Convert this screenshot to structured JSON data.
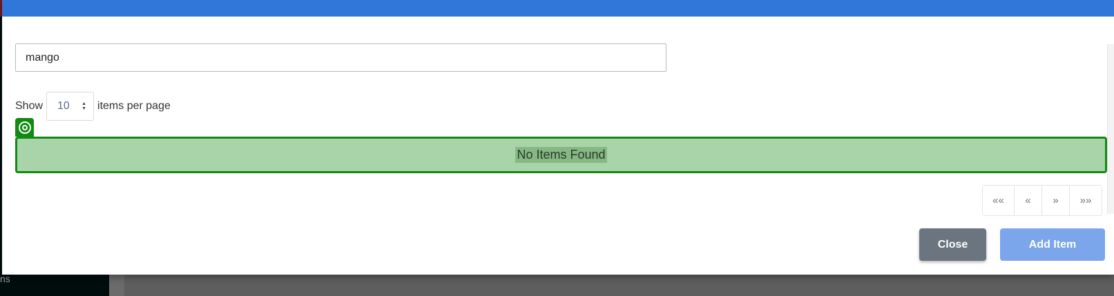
{
  "background": {
    "sidebar_peek_text": "ns"
  },
  "modal": {
    "search": {
      "value": "mango"
    },
    "per_page": {
      "prefix": "Show",
      "selected": "10",
      "suffix": "items per page"
    },
    "results": {
      "empty_message": "No Items Found"
    },
    "pagination": {
      "first": "««",
      "prev": "«",
      "next": "»",
      "last": "»»"
    },
    "footer": {
      "close_label": "Close",
      "add_label": "Add Item"
    }
  },
  "colors": {
    "header": "#3176d9",
    "success_outline": "#128a12",
    "success_fill": "#a9d4a9",
    "close_button": "#6b7580",
    "add_button_disabled": "#7ba6eb"
  },
  "icons": {
    "picker_tab": "target-icon",
    "select_arrows": "sort-arrows-icon"
  }
}
